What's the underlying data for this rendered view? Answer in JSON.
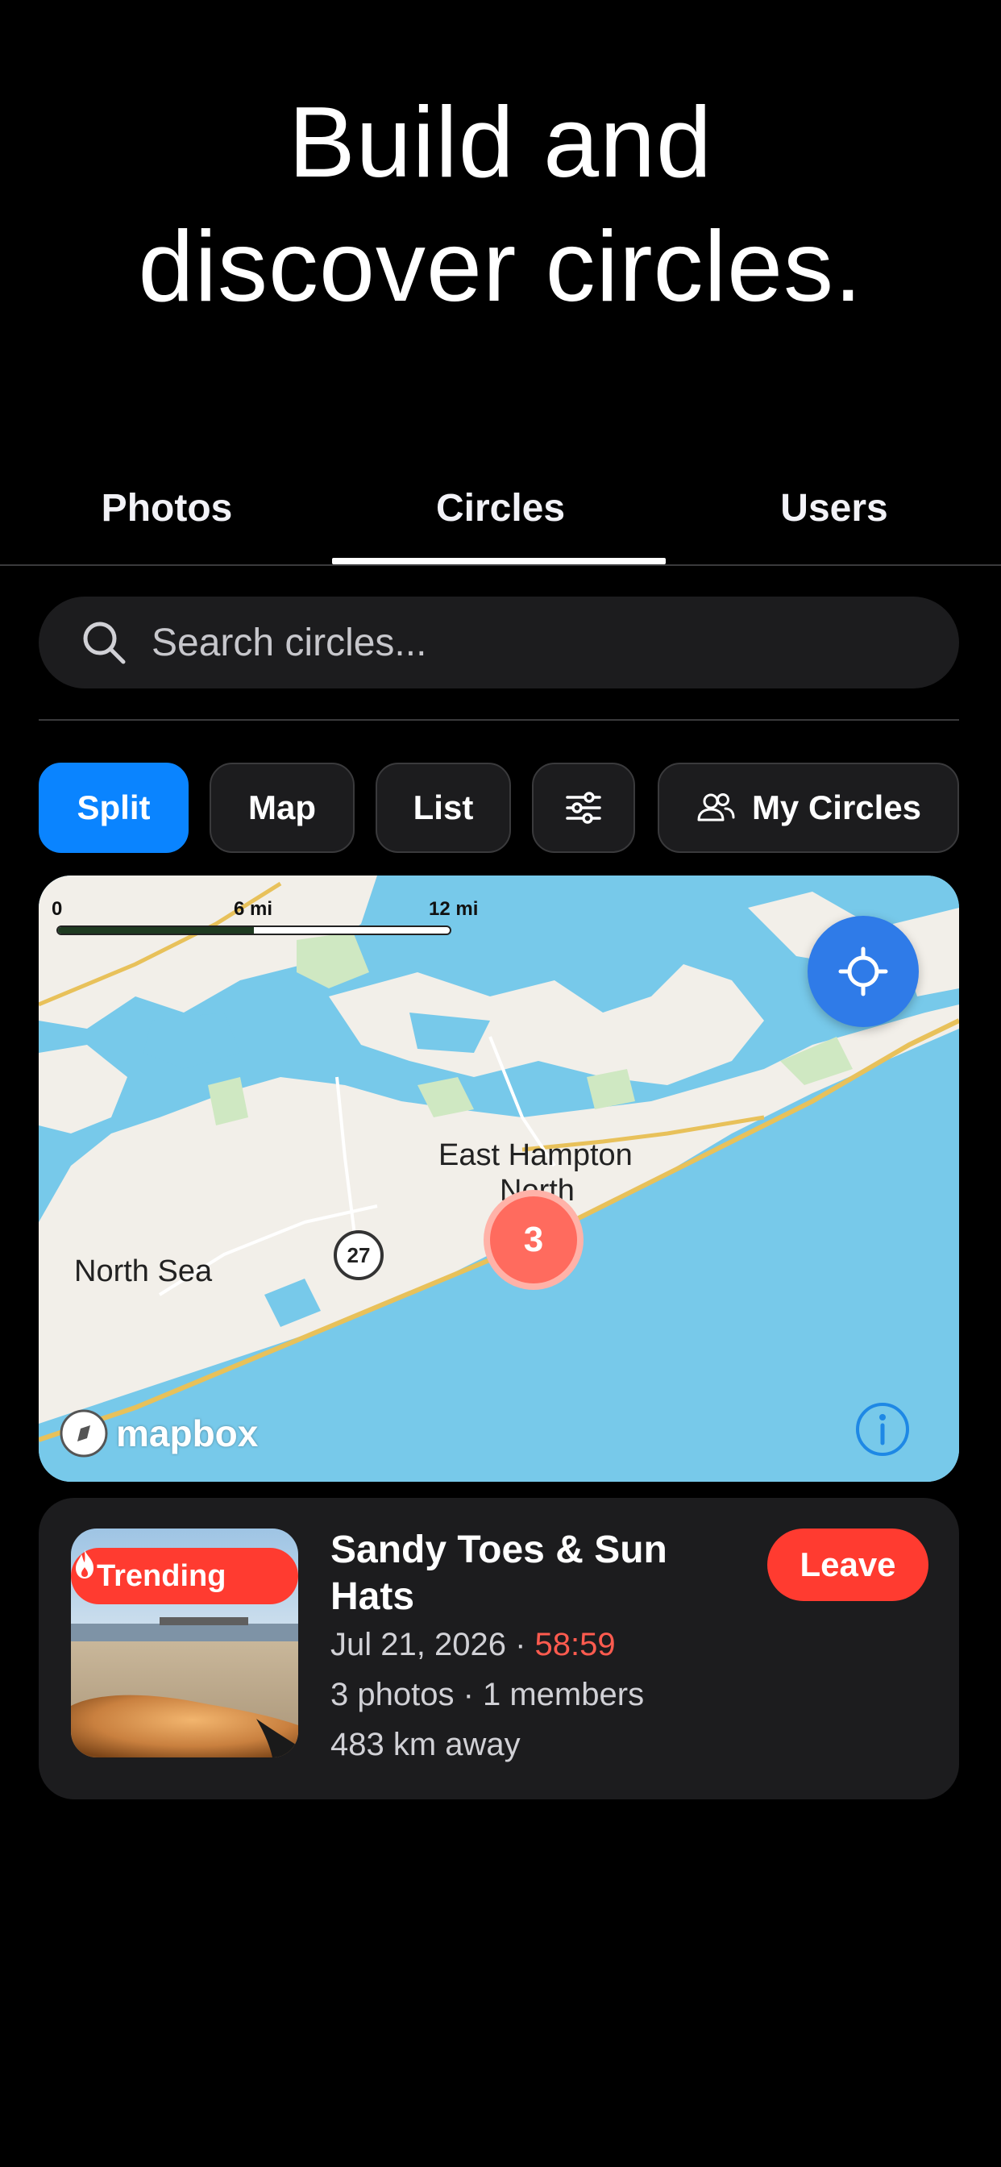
{
  "headline": {
    "line1": "Build and",
    "line2": "discover circles."
  },
  "tabs": [
    {
      "label": "Photos",
      "active": false
    },
    {
      "label": "Circles",
      "active": true
    },
    {
      "label": "Users",
      "active": false
    }
  ],
  "search": {
    "placeholder": "Search circles...",
    "icon": "search-icon"
  },
  "view_chips": {
    "split": "Split",
    "map": "Map",
    "list": "List",
    "filters_icon": "sliders-icon",
    "my_circles": "My Circles",
    "my_circles_icon": "people-icon",
    "active": "Split"
  },
  "map": {
    "scale": {
      "zero": "0",
      "mid": "6 mi",
      "max": "12 mi"
    },
    "labels": {
      "east_hampton_1": "East Hampton",
      "east_hampton_2": "North",
      "north_sea": "North Sea"
    },
    "route_shield": "27",
    "cluster_count": "3",
    "attribution": "mapbox",
    "colors": {
      "water": "#77c9ea",
      "land": "#f2efe9",
      "park": "#cfe8c2",
      "road": "#e8c15a"
    }
  },
  "circle_card": {
    "badge": "Trending",
    "title": "Sandy Toes & Sun Hats",
    "date": "Jul 21, 2026",
    "separator": "·",
    "timer": "58:59",
    "stats": "3 photos · 1 members",
    "distance": "483 km away",
    "action": "Leave"
  },
  "colors": {
    "accent": "#0a84ff",
    "danger": "#ff3b30",
    "locate": "#2f7be8",
    "cluster": "#ff6b5e"
  }
}
